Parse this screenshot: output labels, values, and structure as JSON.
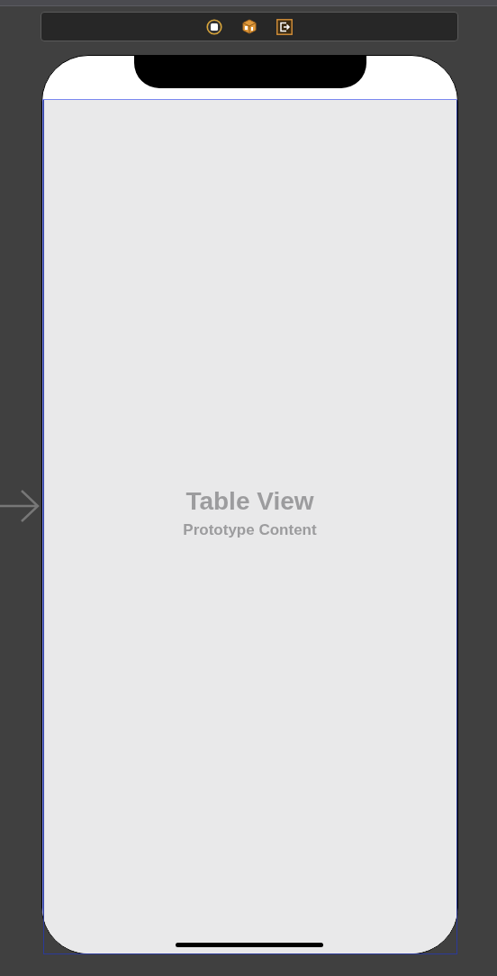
{
  "table_view": {
    "title": "Table View",
    "subtitle": "Prototype Content"
  }
}
